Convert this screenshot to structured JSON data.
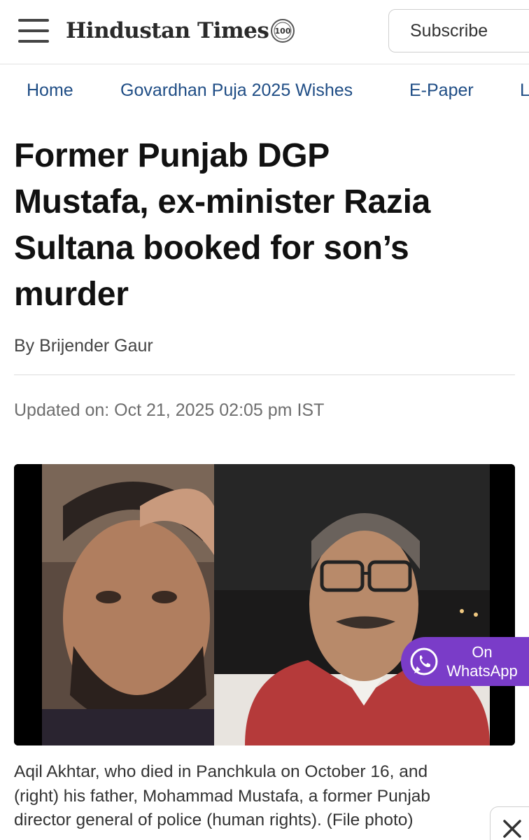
{
  "header": {
    "menu_icon": "hamburger-menu-icon",
    "logo_text": "Hindustan Times",
    "logo_seal_text": "100",
    "subscribe_label": "Subscribe"
  },
  "nav": {
    "items": [
      {
        "label": "Home"
      },
      {
        "label": "Govardhan Puja 2025 Wishes"
      },
      {
        "label": "E-Paper"
      },
      {
        "label": "L"
      }
    ]
  },
  "article": {
    "headline_lines": [
      "Former Punjab DGP",
      "Mustafa, ex-minister Razia",
      "Sultana booked for son’s",
      "murder"
    ],
    "byline_prefix": "By",
    "author": "Brijender Gaur",
    "updated": "Updated on: Oct 21, 2025 02:05 pm IST",
    "caption_lines": [
      "Aqil Akhtar, who died in Panchkula on October 16, and",
      "(right) his father, Mohammad Mustafa, a former Punjab",
      "director general of police (human rights). (File photo)"
    ]
  },
  "whatsapp": {
    "line1": "On",
    "line2": "WhatsApp",
    "icon": "whatsapp-icon",
    "color": "#7a3cc8"
  },
  "close": {
    "icon": "close-icon"
  }
}
